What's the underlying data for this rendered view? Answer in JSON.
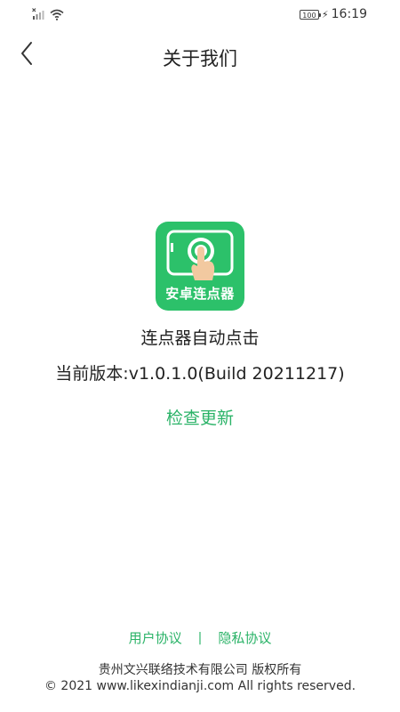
{
  "status_bar": {
    "battery": "100",
    "time": "16:19",
    "signal_icon": "signal-off-icon",
    "wifi_icon": "wifi-icon"
  },
  "header": {
    "title": "关于我们",
    "back_icon": "chevron-left-icon"
  },
  "app": {
    "icon_label": "安卓连点器",
    "name": "连点器自动点击",
    "version": "当前版本:v1.0.1.0(Build 20211217)",
    "check_update": "检查更新"
  },
  "footer": {
    "user_agreement": "用户协议",
    "separator": "|",
    "privacy_policy": "隐私协议",
    "company": "贵州文兴联络技术有限公司 版权所有",
    "copyright": "© 2021 www.likexindianji.com All rights reserved."
  },
  "colors": {
    "accent": "#2bb368",
    "icon_background": "#2cc16a"
  }
}
